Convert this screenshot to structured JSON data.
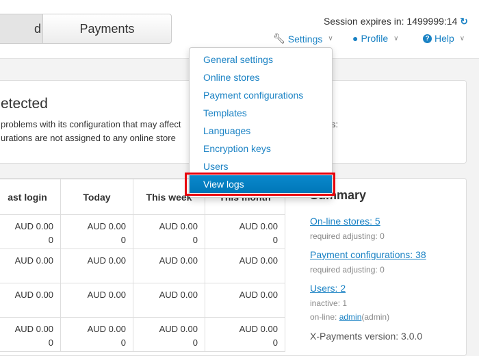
{
  "header": {
    "tabs": [
      {
        "label": "d",
        "active": true
      },
      {
        "label": "Payments",
        "active": false
      }
    ],
    "session": {
      "label": "Session expires in: 1499999:14",
      "icon": "refresh-icon"
    },
    "nav": [
      {
        "label": "Settings",
        "icon": "wrench-icon"
      },
      {
        "label": "Profile",
        "icon": "user-icon"
      },
      {
        "label": "Help",
        "icon": "question-circle-icon"
      }
    ]
  },
  "alert": {
    "title": "etected",
    "line1": "problems with its configuration that may affect",
    "line1_tail": "s:",
    "line2": "urations are not assigned to any online store"
  },
  "table": {
    "headers": [
      "ast login",
      "Today",
      "This week",
      "This month"
    ],
    "rows": [
      [
        "AUD 0.00|0",
        "AUD 0.00|0",
        "AUD 0.00|0",
        "AUD 0.00|0"
      ],
      [
        "AUD 0.00",
        "AUD 0.00",
        "AUD 0.00",
        "AUD 0.00"
      ],
      [
        "AUD 0.00",
        "AUD 0.00",
        "AUD 0.00",
        "AUD 0.00"
      ],
      [
        "AUD 0.00|0",
        "AUD 0.00|0",
        "AUD 0.00|0",
        "AUD 0.00|0"
      ]
    ]
  },
  "summary": {
    "title": "Summary",
    "stores_link": "On-line stores: 5",
    "stores_note": "required adjusting: 0",
    "payconf_link": "Payment configurations: 38",
    "payconf_note": "required adjusting: 0",
    "users_link": "Users: 2",
    "users_inactive": "inactive: 1",
    "online_prefix": "on-line: ",
    "online_user": "admin",
    "online_suffix": "(admin)",
    "version": "X-Payments version: 3.0.0"
  },
  "dropdown": {
    "items": [
      "General settings",
      "Online stores",
      "Payment configurations",
      "Templates",
      "Languages",
      "Encryption keys",
      "Users",
      "View logs"
    ],
    "selected": "View logs"
  },
  "colors": {
    "accent": "#1a82c4",
    "selected": "#0a7fc2",
    "highlight": "#e8000b"
  }
}
